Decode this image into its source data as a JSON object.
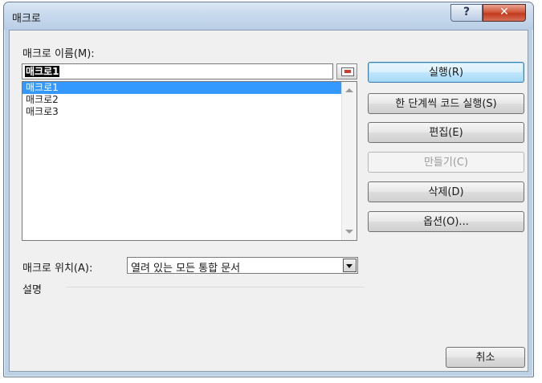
{
  "window": {
    "title": "매크로",
    "help_glyph": "?",
    "close_glyph": "✕"
  },
  "macro_name": {
    "label": "매크로 이름(M):",
    "value": "매크로1"
  },
  "macro_list": {
    "items": [
      "매크로1",
      "매크로2",
      "매크로3"
    ],
    "selected_index": 0
  },
  "buttons": {
    "run": "실행(R)",
    "step_into": "한 단계씩 코드 실행(S)",
    "edit": "편집(E)",
    "create": "만들기(C)",
    "delete": "삭제(D)",
    "options": "옵션(O)...",
    "cancel": "취소"
  },
  "macros_in": {
    "label": "매크로 위치(A):",
    "selected": "열려 있는 모든 통합 문서"
  },
  "description": {
    "label": "설명"
  }
}
